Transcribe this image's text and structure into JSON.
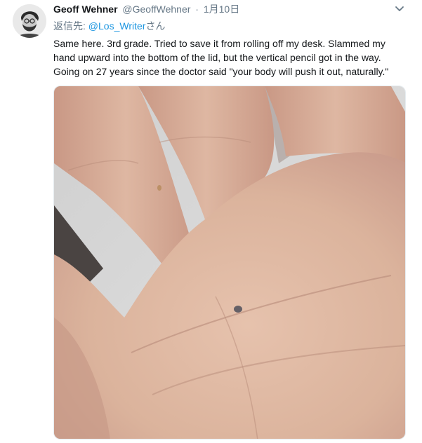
{
  "tweet": {
    "author_name": "Geoff Wehner",
    "author_handle": "@GeoffWehner",
    "separator": "·",
    "timestamp": "1月10日",
    "reply_prefix": "返信先: ",
    "reply_mention": "@Los_Writer",
    "reply_suffix": "さん",
    "text_lines": [
      "Same here.  3rd grade.  Tried to save it from rolling off my desk.  Slammed my",
      "hand upward into the bottom of the lid, but the vertical pencil got in the way.",
      "Going on 27 years since the doctor said \"your body will push it out, naturally.\""
    ],
    "photo_subject": "palm of hand with embedded pencil graphite dot"
  },
  "icons": {
    "caret": "chevron-down-icon",
    "avatar": "bearded-man-avatar"
  },
  "colors": {
    "name": "#14171a",
    "secondary": "#657786",
    "link": "#1b95e0",
    "skin": "#d9b39e",
    "background_wall": "#dcdcdc"
  }
}
